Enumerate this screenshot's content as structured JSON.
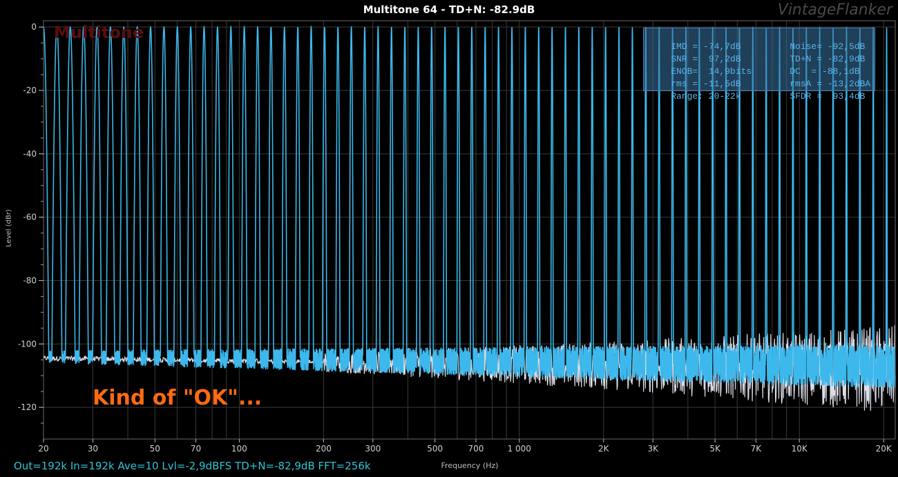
{
  "header": {
    "title": "Multitone 64 - TD+N: -82.9dB",
    "brand": "VintageFlanker"
  },
  "watermark": "Multitone",
  "annotation": "Kind of \"OK\"...",
  "footer": "Out=192k In=192k Ave=10 Lvl=-2,9dBFS TD+N=-82,9dB FFT=256k",
  "stats": [
    [
      "IMD = -74,7dB",
      "Noise= -92,5dB"
    ],
    [
      "SNR =  97,2dB",
      "TD+N = -82,9dB"
    ],
    [
      "ENOB=  14,9bits",
      "DC  = -88,1dB"
    ],
    [
      "rms = -11,5dB",
      "rmsA = -13,2dBA"
    ],
    [
      "Range: 20-22k",
      "SFDR =  93,4dB"
    ]
  ],
  "colors": {
    "tone_trace": "#3cb8ec",
    "noise_trace": "#dcdde8",
    "grid": "#3a3a3a",
    "annotation": "#ff6a12",
    "footer": "#2ec6d6"
  },
  "chart_data": {
    "type": "line",
    "title": "Multitone 64 - TD+N: -82.9dB",
    "xlabel": "Frequency (Hz)",
    "ylabel": "Level (dBr)",
    "x_scale": "log",
    "xlim": [
      20,
      22000
    ],
    "ylim": [
      -130,
      2
    ],
    "grid": true,
    "x_ticks": [
      {
        "value": 20,
        "label": "20"
      },
      {
        "value": 30,
        "label": "30"
      },
      {
        "value": 50,
        "label": "50"
      },
      {
        "value": 70,
        "label": "70"
      },
      {
        "value": 100,
        "label": "100"
      },
      {
        "value": 200,
        "label": "200"
      },
      {
        "value": 300,
        "label": "300"
      },
      {
        "value": 500,
        "label": "500"
      },
      {
        "value": 700,
        "label": "700"
      },
      {
        "value": 1000,
        "label": "1 000"
      },
      {
        "value": 2000,
        "label": "2K"
      },
      {
        "value": 3000,
        "label": "3K"
      },
      {
        "value": 5000,
        "label": "5K"
      },
      {
        "value": 7000,
        "label": "7K"
      },
      {
        "value": 10000,
        "label": "10K"
      },
      {
        "value": 20000,
        "label": "20K"
      }
    ],
    "y_ticks": [
      {
        "value": 0,
        "label": "0"
      },
      {
        "value": -20,
        "label": "-20"
      },
      {
        "value": -40,
        "label": "-40"
      },
      {
        "value": -60,
        "label": "-60"
      },
      {
        "value": -80,
        "label": "-80"
      },
      {
        "value": -100,
        "label": "-100"
      },
      {
        "value": -120,
        "label": "-120"
      }
    ],
    "series": [
      {
        "kind": "tones",
        "tone_count": 64,
        "tone_freq_range": [
          20,
          20500
        ],
        "tone_level": 0,
        "floor_start": -104,
        "floor_end": -107
      },
      {
        "kind": "noise",
        "floor_low_freq": -104.5,
        "floor_high_freq": -108,
        "spread_low": 1,
        "spread_high": 14
      }
    ]
  }
}
